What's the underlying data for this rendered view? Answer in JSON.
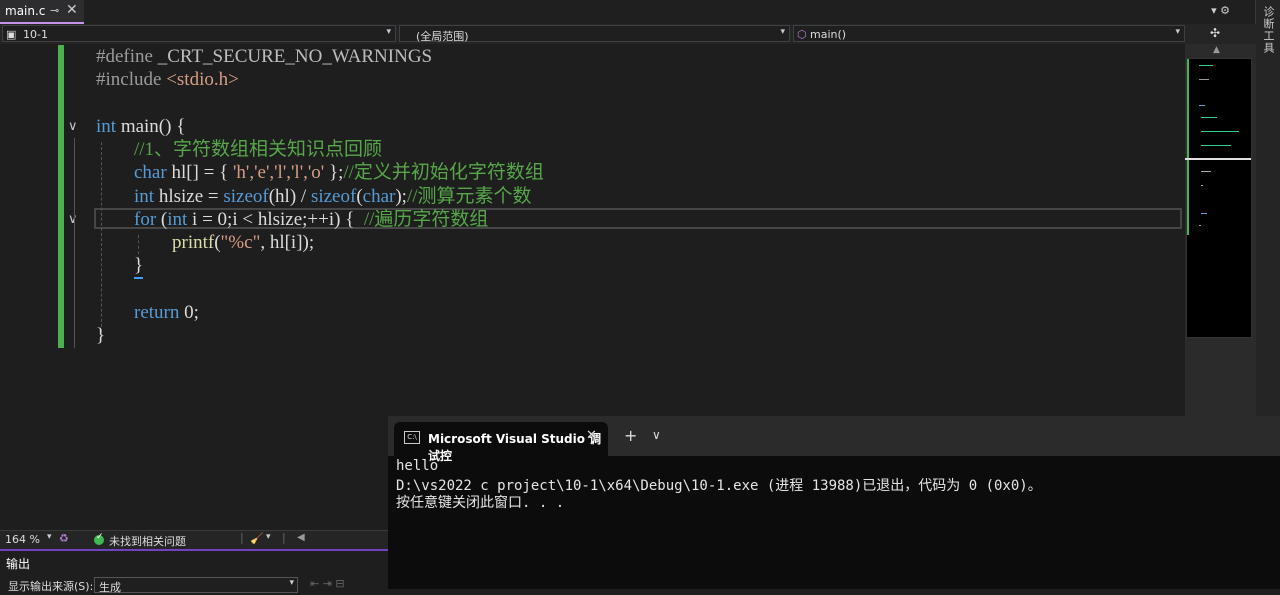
{
  "tab": {
    "filename": "main.c",
    "pin_glyph": "⊸",
    "close_glyph": "✕"
  },
  "right_strip": {
    "label": "诊断工具"
  },
  "tabbar_right_glyphs": "▾  ⚙",
  "nav": {
    "project": "10-1",
    "scope": "(全局范围)",
    "function": "main()"
  },
  "code": {
    "line1": {
      "directive": "#define",
      "name": " _CRT_SECURE_NO_WARNINGS"
    },
    "line2": {
      "directive": "#include",
      "header": " <stdio.h>"
    },
    "line4": {
      "kw": "int",
      "rest": " main() {"
    },
    "line5": {
      "comment": "//1、字符数组相关知识点回顾"
    },
    "line6": {
      "kw": "char",
      "mid": " hl[] = { ",
      "chars": "'h','e','l','l','o'",
      "end": " };",
      "comment": "//定义并初始化字符数组"
    },
    "line7": {
      "kw": "int",
      "mid": " hlsize = ",
      "fn1": "sizeof",
      "a1": "(hl) / ",
      "fn2": "sizeof",
      "a2": "(",
      "kw2": "char",
      "a3": ");",
      "comment": "//测算元素个数"
    },
    "line8": {
      "kw": "for",
      "a": " (",
      "kw2": "int",
      "b": " i = 0;i < hlsize;++i) {  ",
      "comment": "//遍历字符数组"
    },
    "line9": {
      "fn": "printf",
      "a": "(",
      "str": "\"%c\"",
      "b": ", hl[i]);"
    },
    "line10": {
      "text": "}"
    },
    "line12": {
      "kw": "return",
      "rest": " 0;"
    },
    "line13": {
      "text": "}"
    }
  },
  "status": {
    "zoom": "164 %",
    "issues": "未找到相关问题"
  },
  "output": {
    "title": "输出",
    "source_label": "显示输出来源(S):",
    "source_value": "生成"
  },
  "console": {
    "tab_title": "Microsoft Visual Studio 调试控",
    "lines": [
      "hello",
      "D:\\vs2022 c project\\10-1\\x64\\Debug\\10-1.exe (进程 13988)已退出，代码为 0 (0x0)。",
      "按任意键关闭此窗口. . ."
    ]
  }
}
